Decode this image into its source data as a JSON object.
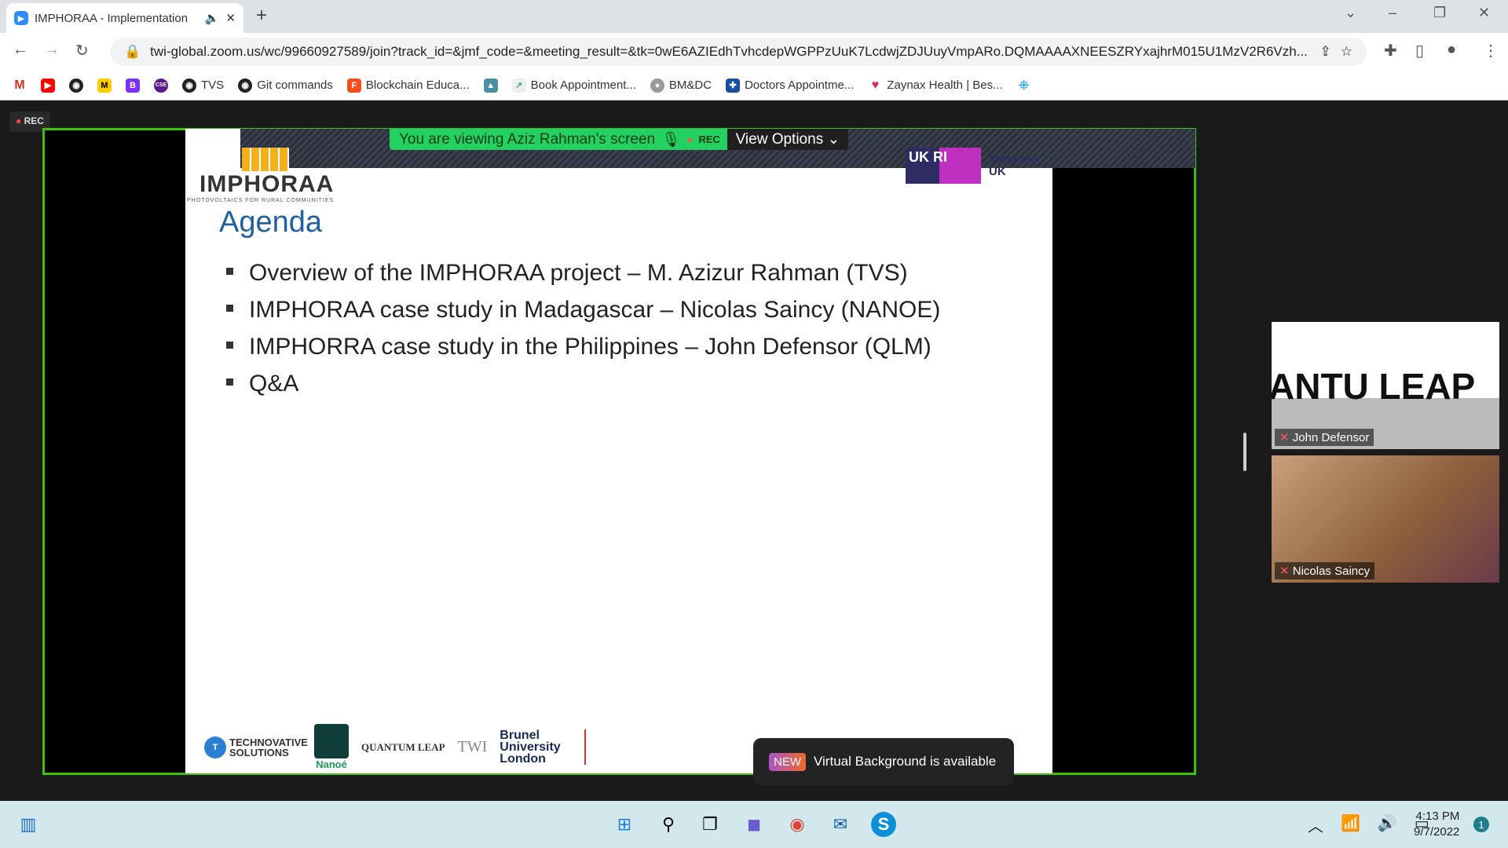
{
  "browser": {
    "tab_title": "IMPHORAA - Implementation",
    "url": "twi-global.zoom.us/wc/99660927589/join?track_id=&jmf_code=&meeting_result=&tk=0wE6AZIEdhTvhcdepWGPPzUuK7LcdwjZDJUuyVmpARo.DQMAAAAXNEESZRYxajhrM015U1MzV2R6Vzh...",
    "bookmarks": [
      "TVS",
      "Git commands",
      "Blockchain Educa...",
      "Book Appointment...",
      "BM&DC",
      "Doctors Appointme...",
      "Zaynax Health | Bes..."
    ]
  },
  "meeting": {
    "rec_label": "REC",
    "banner": "You are viewing Aziz Rahman's screen",
    "banner_rec": "REC",
    "view_options": "View Options",
    "toast_badge": "NEW",
    "toast_text": "Virtual Background is available",
    "participants": [
      {
        "name": "John Defensor",
        "bg_text": "ANTU   LEAP"
      },
      {
        "name": "Nicolas Saincy"
      }
    ]
  },
  "slide": {
    "logo": "IMPHORAA",
    "logo_sub": "PHOTOVOLTAICS FOR RURAL COMMUNITIES",
    "ukri": "UK RI",
    "innovate": "Innovate UK",
    "title": "Agenda",
    "bullets": [
      "Overview of the IMPHORAA project – M. Azizur Rahman (TVS)",
      "IMPHORAA case study in Madagascar – Nicolas Saincy (NANOE)",
      "IMPHORRA case study in the Philippines – John Defensor (QLM)",
      "Q&A"
    ],
    "partners": [
      "TECHNOVATIVE SOLUTIONS",
      "Nanoé",
      "QUANTUM LEAP",
      "TWI",
      "Brunel University London"
    ]
  },
  "taskbar": {
    "time": "4:13 PM",
    "date": "9/7/2022",
    "notifications": "1"
  },
  "colors": {
    "share_border": "#39c40a",
    "banner": "#23d160",
    "agenda": "#1f5fa3"
  }
}
